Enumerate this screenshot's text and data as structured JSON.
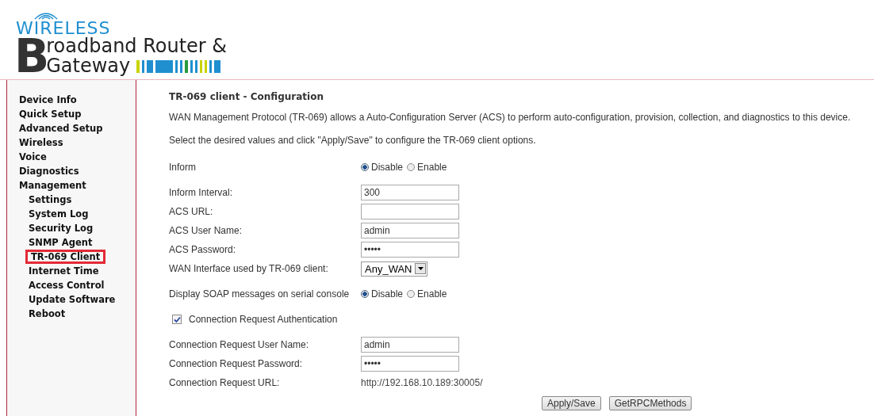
{
  "logo": {
    "wireless": "WIRELESS",
    "initial": "B",
    "line_1": "roadband Router &",
    "line_2": "Gateway"
  },
  "sidebar": {
    "items": [
      {
        "label": "Device Info",
        "selected": false
      },
      {
        "label": "Quick Setup",
        "selected": false
      },
      {
        "label": "Advanced Setup",
        "selected": false
      },
      {
        "label": "Wireless",
        "selected": false
      },
      {
        "label": "Voice",
        "selected": false
      },
      {
        "label": "Diagnostics",
        "selected": false
      },
      {
        "label": "Management",
        "selected": false,
        "children": [
          {
            "label": "Settings",
            "selected": false
          },
          {
            "label": "System Log",
            "selected": false
          },
          {
            "label": "Security Log",
            "selected": false
          },
          {
            "label": "SNMP Agent",
            "selected": false
          },
          {
            "label": "TR-069 Client",
            "selected": true
          },
          {
            "label": "Internet Time",
            "selected": false
          },
          {
            "label": "Access Control",
            "selected": false
          },
          {
            "label": "Update Software",
            "selected": false
          },
          {
            "label": "Reboot",
            "selected": false
          }
        ]
      }
    ]
  },
  "content": {
    "title": "TR-069 client - Configuration",
    "paragraphs": [
      "WAN Management Protocol (TR-069) allows a Auto-Configuration Server (ACS) to perform auto-configuration, provision, collection, and diagnostics to this device.",
      "Select the desired values and click \"Apply/Save\" to configure the TR-069 client options."
    ],
    "fields": [
      {
        "kind": "radio",
        "label": "Inform",
        "options": [
          {
            "label": "Disable",
            "selected": true
          },
          {
            "label": "Enable",
            "selected": false
          }
        ]
      },
      {
        "kind": "text",
        "label": "Inform Interval:",
        "value": "300"
      },
      {
        "kind": "text",
        "label": "ACS URL:"
      },
      {
        "kind": "text",
        "label": "ACS User Name:",
        "value": "admin"
      },
      {
        "kind": "password",
        "label": "ACS Password:",
        "value": "•••••"
      },
      {
        "kind": "select",
        "label": "WAN Interface used by TR-069 client:",
        "value": "Any_WAN"
      },
      {
        "kind": "radio",
        "label": "Display SOAP messages on serial console",
        "options": [
          {
            "label": "Disable",
            "selected": true
          },
          {
            "label": "Enable",
            "selected": false
          }
        ]
      },
      {
        "kind": "checkbox",
        "label": "Connection Request Authentication",
        "checked": true
      },
      {
        "kind": "text",
        "label": "Connection Request User Name:",
        "value": "admin"
      },
      {
        "kind": "password",
        "label": "Connection Request Password:",
        "value": "•••••"
      },
      {
        "kind": "static",
        "label": "Connection Request URL:",
        "value": "http://192.168.10.189:30005/"
      }
    ],
    "buttons": [
      "Apply/Save",
      "GetRPCMethods"
    ]
  }
}
